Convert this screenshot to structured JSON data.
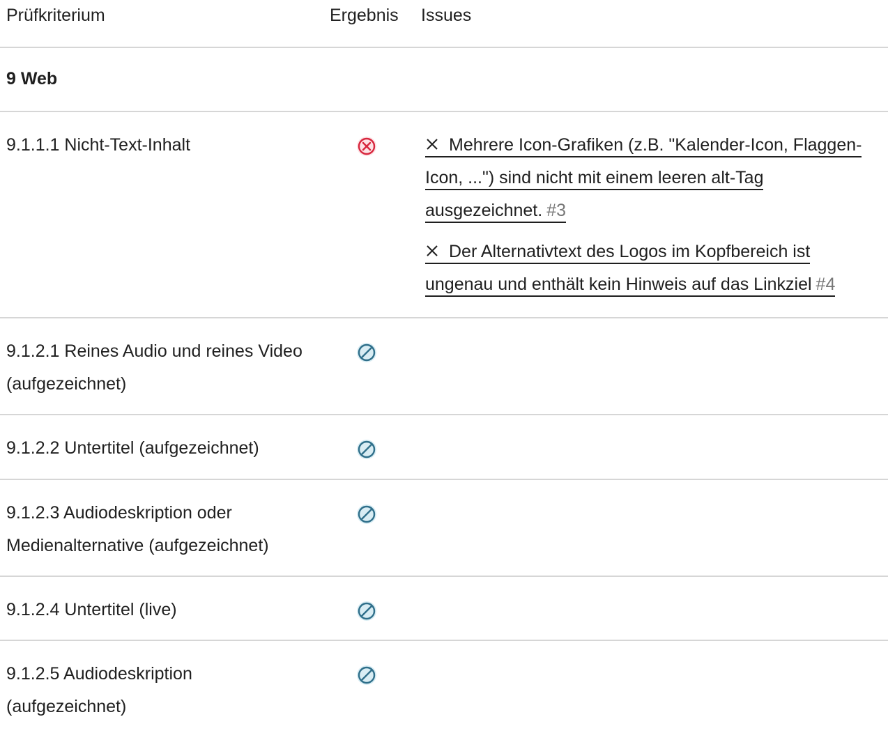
{
  "header": {
    "criterion": "Prüfkriterium",
    "result": "Ergebnis",
    "issues": "Issues"
  },
  "section": {
    "title": "9 Web"
  },
  "rows": [
    {
      "criterion": "9.1.1.1 Nicht-Text-Inhalt",
      "result": "failed",
      "issues": [
        {
          "text": "Mehrere Icon-Grafiken (z.B. \"Kalender-Icon, Flaggen-Icon, ...\") sind nicht mit einem leeren alt-Tag ausgezeichnet.",
          "number": "#3"
        },
        {
          "text": "Der Alternativtext des Logos im Kopfbereich ist ungenau und enthält kein Hinweis auf das Linkziel",
          "number": "#4"
        }
      ]
    },
    {
      "criterion": "9.1.2.1 Reines Audio und reines Video (aufgezeichnet)",
      "result": "not-applicable"
    },
    {
      "criterion": "9.1.2.2 Untertitel (aufgezeichnet)",
      "result": "not-applicable"
    },
    {
      "criterion": "9.1.2.3 Audiodeskription oder Medienalternative (aufgezeichnet)",
      "result": "not-applicable"
    },
    {
      "criterion": "9.1.2.4 Untertitel (live)",
      "result": "not-applicable"
    },
    {
      "criterion": "9.1.2.5 Audiodeskription (aufgezeichnet)",
      "result": "not-applicable"
    }
  ],
  "icons": {
    "failed": "failed-x-circle-icon",
    "not_applicable": "not-applicable-icon",
    "issue": "close-x-icon"
  },
  "colors": {
    "failed": "#d7263d",
    "not_applicable": "#2f6f8a",
    "divider": "#d6d6d6",
    "issue_number": "#777777"
  }
}
